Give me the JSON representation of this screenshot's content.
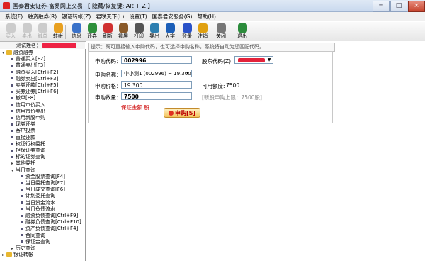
{
  "window": {
    "title": "国泰君安证券-富易网上交易   【 隐藏/恢复键: Alt + Z 】",
    "minimize": "─",
    "maximize": "□",
    "close": "×"
  },
  "menu": [
    "系统(F)",
    "融资融券(R)",
    "银证转帐(Z)",
    "君联天下(L)",
    "设置(T)",
    "国泰君安服务(G)",
    "帮助(H)"
  ],
  "toolbar": {
    "buttons": [
      {
        "label": "买入",
        "icon": "buy-icon",
        "enabled": false,
        "color": "#cccccc"
      },
      {
        "label": "卖出",
        "icon": "sell-icon",
        "enabled": false,
        "color": "#cccccc"
      },
      {
        "label": "撤单",
        "icon": "cancel-order-icon",
        "enabled": false,
        "color": "#cccccc"
      },
      {
        "label": "转帐",
        "icon": "transfer-icon",
        "enabled": true,
        "color": "#e8a020"
      },
      {
        "label": "信息",
        "icon": "info-icon",
        "enabled": true,
        "color": "#3a72c9"
      },
      {
        "label": "还券",
        "icon": "return-stock-icon",
        "enabled": true,
        "color": "#2d8f3a"
      },
      {
        "label": "刷新",
        "icon": "refresh-icon",
        "enabled": true,
        "color": "#d03030"
      },
      {
        "label": "锁屏",
        "icon": "lock-screen-icon",
        "enabled": true,
        "color": "#8a5a2a"
      },
      {
        "label": "打印",
        "icon": "print-icon",
        "enabled": true,
        "color": "#555555"
      },
      {
        "label": "导出",
        "icon": "export-icon",
        "enabled": true,
        "color": "#2d7fb0"
      },
      {
        "label": "大字",
        "icon": "large-font-icon",
        "enabled": true,
        "color": "#1c5fb8"
      },
      {
        "label": "登录",
        "icon": "login-icon",
        "enabled": true,
        "color": "#2a52c8"
      },
      {
        "label": "注销",
        "icon": "logout-icon",
        "enabled": true,
        "color": "#e0a010"
      },
      {
        "label": "关闭",
        "icon": "close-window-icon",
        "enabled": true,
        "color": "#777777"
      },
      {
        "label": "退出",
        "icon": "exit-icon",
        "enabled": true,
        "color": "#2c8c3c"
      }
    ]
  },
  "tree_header": {
    "label": "测试姓名："
  },
  "tree": [
    {
      "label": "融资融券",
      "level": 0,
      "expander": "-",
      "folder": true
    },
    {
      "label": "普通买入[F2]",
      "level": 1
    },
    {
      "label": "普通卖出[F3]",
      "level": 1
    },
    {
      "label": "融资买入[Ctrl+F2]",
      "level": 1
    },
    {
      "label": "融券卖出[Ctrl+F3]",
      "level": 1
    },
    {
      "label": "卖券还款[Ctrl+F5]",
      "level": 1
    },
    {
      "label": "买券还券[Ctrl+F6]",
      "level": 1
    },
    {
      "label": "撤单[F8]",
      "level": 1
    },
    {
      "label": "信用市价买入",
      "level": 1
    },
    {
      "label": "信用市价卖出",
      "level": 1
    },
    {
      "label": "信用新股申购",
      "level": 1
    },
    {
      "label": "现券还券",
      "level": 1
    },
    {
      "label": "客户投票",
      "level": 1
    },
    {
      "label": "直接还款",
      "level": 1
    },
    {
      "label": "权证行权委托",
      "level": 1
    },
    {
      "label": "担保证券查询",
      "level": 1
    },
    {
      "label": "标的证券查询",
      "level": 1
    },
    {
      "label": "其他委托",
      "level": 1,
      "expander": "+"
    },
    {
      "label": "当日查询",
      "level": 1,
      "expander": "-"
    },
    {
      "label": "资金股票查询[F4]",
      "level": 2
    },
    {
      "label": "当日委托查询[F7]",
      "level": 2
    },
    {
      "label": "当日成交查询[F6]",
      "level": 2
    },
    {
      "label": "计划委托查询",
      "level": 2
    },
    {
      "label": "当日资金流水",
      "level": 2
    },
    {
      "label": "当日负债流水",
      "level": 2
    },
    {
      "label": "融资负债查询[Ctrl+F9]",
      "level": 2
    },
    {
      "label": "融券负债查询[Ctrl+F10]",
      "level": 2
    },
    {
      "label": "资产负债查询[Ctrl+F4]",
      "level": 2
    },
    {
      "label": "合同查询",
      "level": 2
    },
    {
      "label": "保证金查询",
      "level": 2
    },
    {
      "label": "历史查询",
      "level": 1,
      "expander": "+"
    },
    {
      "label": "银证转帐",
      "level": 0,
      "expander": "+",
      "folder": true
    }
  ],
  "hint": "提示：既可直接输入申购代码，也可选择申购名称，系统将自动为您匹配代码。",
  "form": {
    "code_label": "申购代码：",
    "code_value": "002996",
    "account_label": "股东代码(Z)",
    "name_label": "申购名称：",
    "name_value": "中小测1 (002996)  ~  19.300",
    "price_label": "申购价格：",
    "price_value": "19.300",
    "available_label": "可用额度:",
    "available_value": "7500",
    "qty_label": "申购数量：",
    "qty_value": "7500",
    "max_label": "[新股申购上限：7500股]",
    "max_color": "#888888",
    "red_hint": "保证金额 股",
    "submit": "申购[S]"
  }
}
